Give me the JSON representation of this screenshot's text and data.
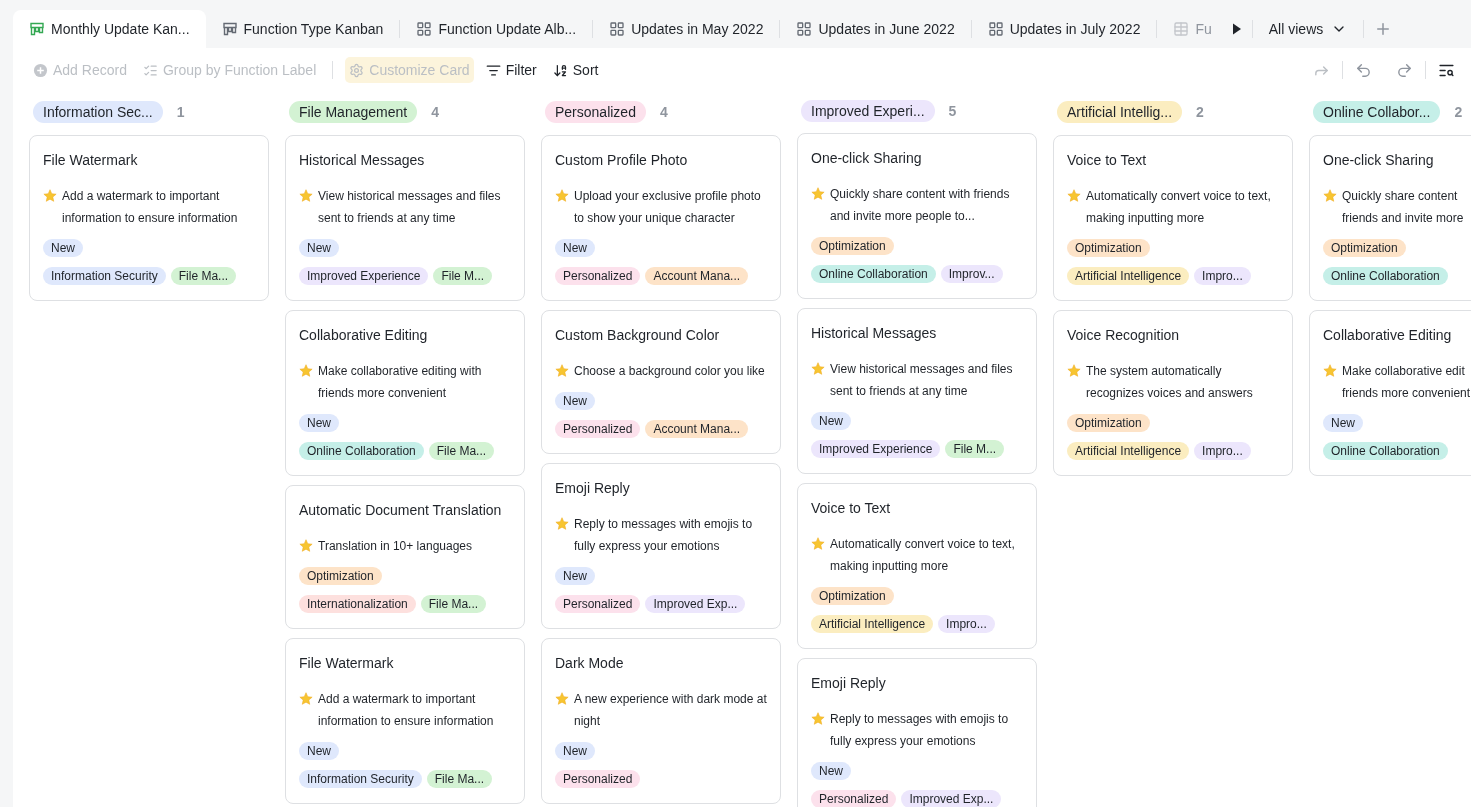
{
  "tabs": [
    {
      "label": "Monthly Update Kan...",
      "kind": "kanban",
      "selected": true
    },
    {
      "label": "Function Type Kanban",
      "kind": "kanban",
      "selected": false
    },
    {
      "label": "Function Update Alb...",
      "kind": "gallery",
      "selected": false
    },
    {
      "label": "Updates in May 2022",
      "kind": "gallery",
      "selected": false
    },
    {
      "label": "Updates in June 2022",
      "kind": "gallery",
      "selected": false
    },
    {
      "label": "Updates in July 2022",
      "kind": "gallery",
      "selected": false
    },
    {
      "label": "Fu",
      "kind": "table",
      "selected": false
    }
  ],
  "views_menu": {
    "label": "All views"
  },
  "toolbar": [
    {
      "label": "Add Record",
      "kind": "add",
      "disabled": true
    },
    {
      "label": "Group by Function Label",
      "kind": "group",
      "disabled": true
    },
    {
      "label": "Customize Card",
      "kind": "customize",
      "disabled": true
    },
    {
      "label": "Filter",
      "kind": "filter",
      "disabled": false
    },
    {
      "label": "Sort",
      "kind": "sort",
      "disabled": false
    }
  ],
  "columns": [
    {
      "label": "Information Sec...",
      "color": "#dfe8fc",
      "count": "1",
      "cards": [
        {
          "title": "File Watermark",
          "description": "Add a watermark to important information to ensure information",
          "status": {
            "label": "New",
            "color": "#dfe8fc"
          },
          "labels": [
            {
              "label": "Information Security",
              "color": "#dfe8fc"
            },
            {
              "label": "File Ma...",
              "color": "#d3f2d3"
            }
          ]
        }
      ]
    },
    {
      "label": "File Management",
      "color": "#d3f2d3",
      "count": "4",
      "cards": [
        {
          "title": "Historical Messages",
          "description": "View historical messages and files sent to friends at any time",
          "status": {
            "label": "New",
            "color": "#dfe8fc"
          },
          "labels": [
            {
              "label": "Improved Experience",
              "color": "#ece6fc"
            },
            {
              "label": "File M...",
              "color": "#d3f2d3"
            }
          ]
        },
        {
          "title": "Collaborative Editing",
          "description": "Make collaborative editing with friends more convenient",
          "status": {
            "label": "New",
            "color": "#dfe8fc"
          },
          "labels": [
            {
              "label": "Online Collaboration",
              "color": "#c5efe8"
            },
            {
              "label": "File Ma...",
              "color": "#d3f2d3"
            }
          ]
        },
        {
          "title": "Automatic Document Translation",
          "description": "Translation in 10+ languages",
          "status": {
            "label": "Optimization",
            "color": "#fde3c8"
          },
          "labels": [
            {
              "label": "Internationalization",
              "color": "#fde0de"
            },
            {
              "label": "File Ma...",
              "color": "#d3f2d3"
            }
          ]
        },
        {
          "title": "File Watermark",
          "description": "Add a watermark to important information to ensure information",
          "status": {
            "label": "New",
            "color": "#dfe8fc"
          },
          "labels": [
            {
              "label": "Information Security",
              "color": "#dfe8fc"
            },
            {
              "label": "File Ma...",
              "color": "#d3f2d3"
            }
          ]
        }
      ]
    },
    {
      "label": "Personalized",
      "color": "#fce1ec",
      "count": "4",
      "cards": [
        {
          "title": "Custom Profile Photo",
          "description": "Upload your exclusive profile photo to show your unique character",
          "status": {
            "label": "New",
            "color": "#dfe8fc"
          },
          "labels": [
            {
              "label": "Personalized",
              "color": "#fce1ec"
            },
            {
              "label": "Account Mana...",
              "color": "#fde3c8"
            }
          ]
        },
        {
          "title": "Custom Background Color",
          "description": "Choose a background color you like",
          "status": {
            "label": "New",
            "color": "#dfe8fc"
          },
          "labels": [
            {
              "label": "Personalized",
              "color": "#fce1ec"
            },
            {
              "label": "Account Mana...",
              "color": "#fde3c8"
            }
          ]
        },
        {
          "title": "Emoji Reply",
          "description": "Reply to messages with emojis to fully express your emotions",
          "status": {
            "label": "New",
            "color": "#dfe8fc"
          },
          "labels": [
            {
              "label": "Personalized",
              "color": "#fce1ec"
            },
            {
              "label": "Improved Exp...",
              "color": "#ece6fc"
            }
          ]
        },
        {
          "title": "Dark Mode",
          "description": "A new experience with dark mode at night",
          "status": {
            "label": "New",
            "color": "#dfe8fc"
          },
          "labels": [
            {
              "label": "Personalized",
              "color": "#fce1ec"
            }
          ]
        }
      ]
    },
    {
      "label": "Improved Experi...",
      "color": "#ece6fc",
      "count": "5",
      "cards": [
        {
          "title": "One-click Sharing",
          "description": "Quickly share content with friends and invite more people to...",
          "status": {
            "label": "Optimization",
            "color": "#fde3c8"
          },
          "labels": [
            {
              "label": "Online Collaboration",
              "color": "#c5efe8"
            },
            {
              "label": "Improv...",
              "color": "#ece6fc"
            }
          ]
        },
        {
          "title": "Historical Messages",
          "description": "View historical messages and files sent to friends at any time",
          "status": {
            "label": "New",
            "color": "#dfe8fc"
          },
          "labels": [
            {
              "label": "Improved Experience",
              "color": "#ece6fc"
            },
            {
              "label": "File M...",
              "color": "#d3f2d3"
            }
          ]
        },
        {
          "title": "Voice to Text",
          "description": "Automatically convert voice to text, making inputting more",
          "status": {
            "label": "Optimization",
            "color": "#fde3c8"
          },
          "labels": [
            {
              "label": "Artificial Intelligence",
              "color": "#fbedc0"
            },
            {
              "label": "Impro...",
              "color": "#ece6fc"
            }
          ]
        },
        {
          "title": "Emoji Reply",
          "description": "Reply to messages with emojis to fully express your emotions",
          "status": {
            "label": "New",
            "color": "#dfe8fc"
          },
          "labels": [
            {
              "label": "Personalized",
              "color": "#fce1ec"
            },
            {
              "label": "Improved Exp...",
              "color": "#ece6fc"
            }
          ]
        }
      ]
    },
    {
      "label": "Artificial Intellig...",
      "color": "#fbedc0",
      "count": "2",
      "cards": [
        {
          "title": "Voice to Text",
          "description": "Automatically convert voice to text, making inputting more",
          "status": {
            "label": "Optimization",
            "color": "#fde3c8"
          },
          "labels": [
            {
              "label": "Artificial Intelligence",
              "color": "#fbedc0"
            },
            {
              "label": "Impro...",
              "color": "#ece6fc"
            }
          ]
        },
        {
          "title": "Voice Recognition",
          "description": "The system automatically recognizes voices and answers",
          "status": {
            "label": "Optimization",
            "color": "#fde3c8"
          },
          "labels": [
            {
              "label": "Artificial Intelligence",
              "color": "#fbedc0"
            },
            {
              "label": "Impro...",
              "color": "#ece6fc"
            }
          ]
        }
      ]
    },
    {
      "label": "Online Collabor...",
      "color": "#c5efe8",
      "count": "2",
      "cards": [
        {
          "title": "One-click Sharing",
          "description": "Quickly share content\nfriends and invite more",
          "status": {
            "label": "Optimization",
            "color": "#fde3c8"
          },
          "labels": [
            {
              "label": "Online Collaboration",
              "color": "#c5efe8"
            }
          ]
        },
        {
          "title": "Collaborative Editing",
          "description": "Make collaborative edit\nfriends more convenient",
          "status": {
            "label": "New",
            "color": "#dfe8fc"
          },
          "labels": [
            {
              "label": "Online Collaboration",
              "color": "#c5efe8"
            }
          ]
        }
      ]
    }
  ]
}
